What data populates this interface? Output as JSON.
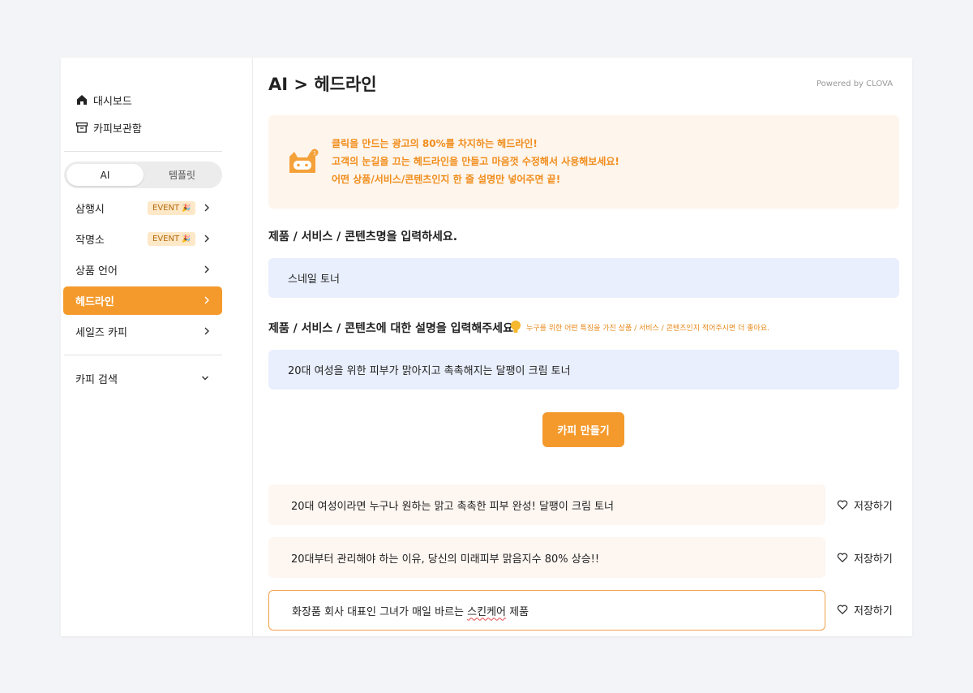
{
  "sidebar": {
    "top_items": [
      {
        "label": "대시보드",
        "icon": "home-icon"
      },
      {
        "label": "카피보관함",
        "icon": "archive-icon"
      }
    ],
    "toggle": {
      "ai": "AI",
      "template": "템플릿"
    },
    "menu": [
      {
        "label": "삼행시",
        "badge": "EVENT",
        "badge_emoji": "🎉"
      },
      {
        "label": "작명소",
        "badge": "EVENT",
        "badge_emoji": "🎉"
      },
      {
        "label": "상품 언어"
      },
      {
        "label": "헤드라인",
        "active": true
      },
      {
        "label": "세일즈 카피"
      }
    ],
    "search": {
      "label": "카피 검색"
    }
  },
  "header": {
    "breadcrumb_parent": "AI",
    "breadcrumb_sep": ">",
    "breadcrumb_current": "헤드라인",
    "powered_by": "Powered by CLOVA"
  },
  "notice": {
    "lines": [
      "클릭을 만드는 광고의 80%를 차지하는 헤드라인!",
      "고객의 눈길을 끄는 헤드라인을 만들고 마음껏 수정해서 사용해보세요!",
      "어떤 상품/서비스/콘텐츠인지 한 줄 설명만 넣어주면 끝!"
    ]
  },
  "form": {
    "product_label": "제품 / 서비스 / 콘텐츠명을 입력하세요.",
    "product_value": "스네일 토너",
    "desc_label": "제품 / 서비스 / 콘텐츠에 대한 설명을 입력해주세요.",
    "desc_hint": "누구를 위한 어떤 특징을 가진 상품 / 서비스 / 콘텐츠인지 적어주시면 더 좋아요.",
    "desc_value": "20대 여성을 위한 피부가 맑아지고 촉촉해지는 달팽이 크림 토너",
    "make_button": "카피 만들기"
  },
  "results": [
    {
      "text": "20대 여성이라면 누구나 원하는 맑고 촉촉한 피부 완성! 달팽이 크림 토너"
    },
    {
      "text": "20대부터 관리해야 하는 이유, 당신의 미래피부 맑음지수 80% 상승!!"
    },
    {
      "text_before": "화장품 회사 대표인 그녀가 매일 바르는 ",
      "text_squiggle": "스킨케어",
      "text_after": " 제품"
    }
  ],
  "save_label": "저장하기",
  "colors": {
    "accent": "#f49a2c",
    "notice_bg": "#fef5ec",
    "input_bg": "#e9effc",
    "result_bg": "#fdf6f1"
  }
}
